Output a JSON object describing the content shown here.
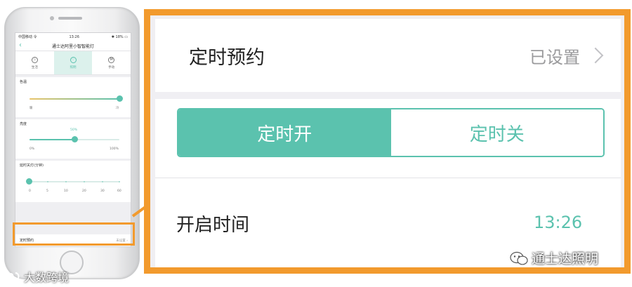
{
  "phone": {
    "status": {
      "carrier": "中国移动 令",
      "time": "13:26",
      "battery": "✱ 18% ▭"
    },
    "nav": {
      "back": "‹",
      "title": "通士达阿里小智智能灯"
    },
    "modes": [
      {
        "label": "生活",
        "icon": "sprout-icon",
        "glyph": "♧"
      },
      {
        "label": "照明",
        "icon": "bulb-icon",
        "glyph": "♡"
      },
      {
        "label": "手动",
        "icon": "manual-icon",
        "glyph": "M"
      }
    ],
    "color_temp": {
      "title": "色温",
      "min_label": "暖",
      "max_label": "冷",
      "level": 1.0
    },
    "brightness": {
      "title": "亮度",
      "value_label": "50%",
      "min_label": "0%",
      "max_label": "100%",
      "level": 0.5
    },
    "delay_off": {
      "title": "延时关灯(分钟)",
      "ticks": [
        "0",
        "5",
        "10",
        "20",
        "30",
        "60"
      ],
      "selected": "0"
    },
    "schedule": {
      "label": "定时预约",
      "value": "未设置",
      "chevron": "›"
    }
  },
  "zoom": {
    "schedule_title": "定时预约",
    "schedule_value": "已设置",
    "tabs": [
      "定时开",
      "定时关"
    ],
    "time_label": "开启时间",
    "time_value": "13:26"
  },
  "watermarks": {
    "right": "通士达照明",
    "left": "大数跨境"
  },
  "colors": {
    "accent": "#5bc2ae",
    "highlight": "#f29a2d"
  }
}
